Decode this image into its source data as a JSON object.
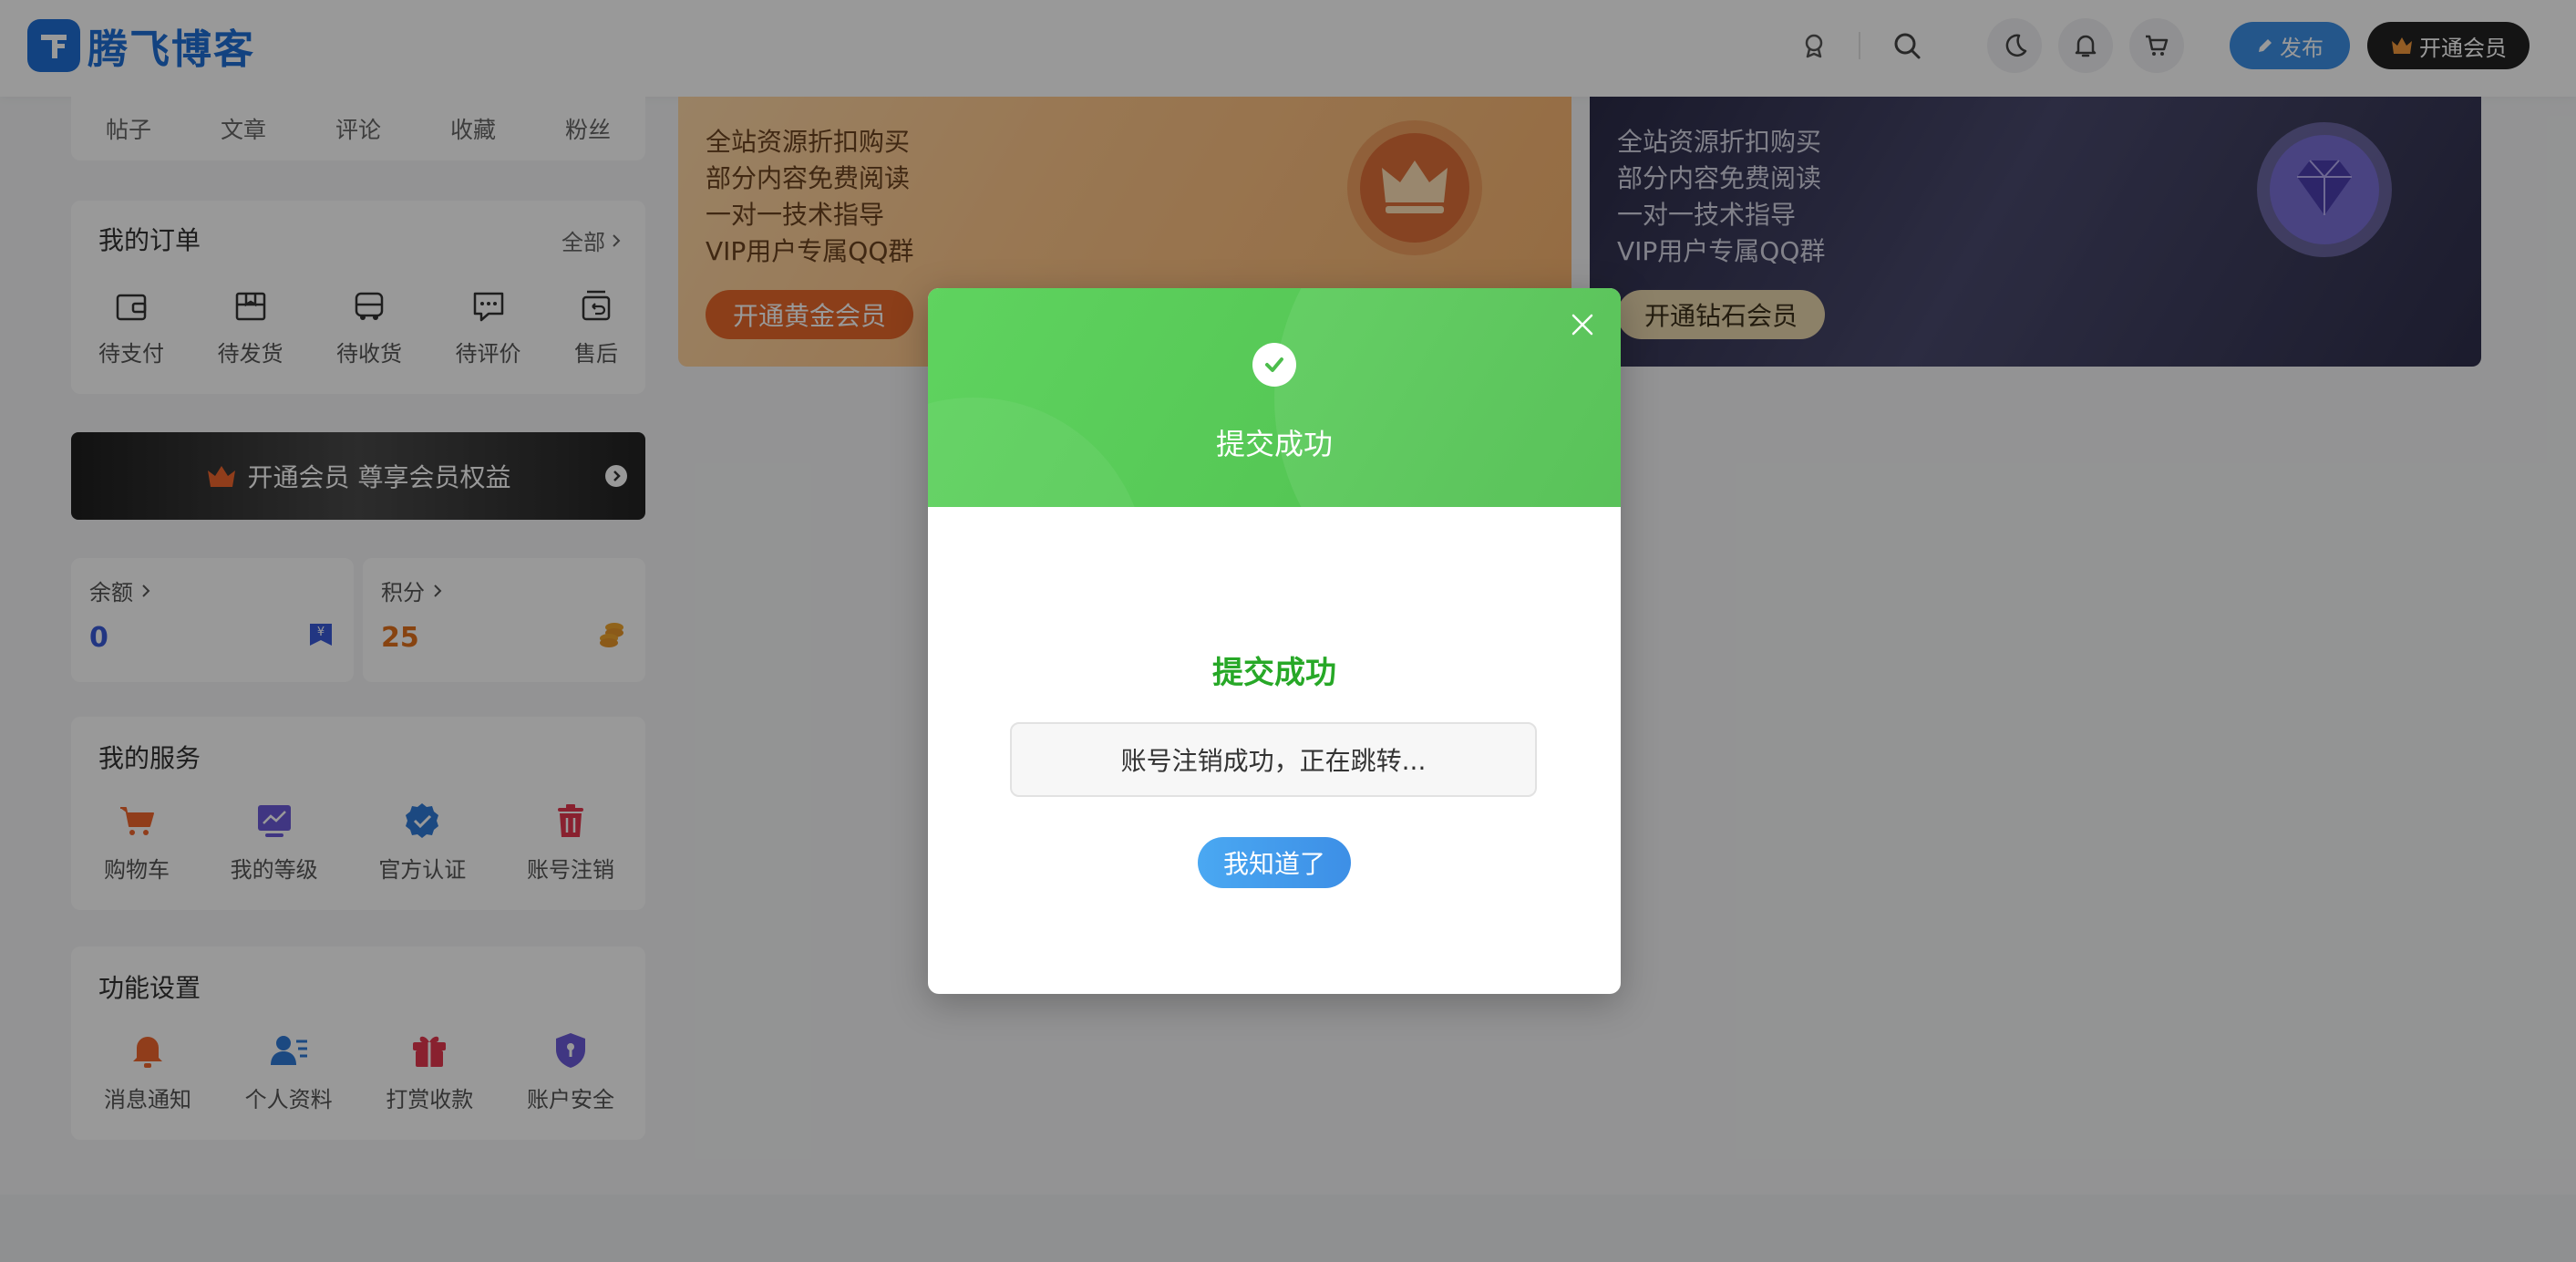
{
  "header": {
    "logo_text": "腾飞博客",
    "publish_label": "发布",
    "vip_label": "开通会员"
  },
  "stats": {
    "items": [
      "帖子",
      "文章",
      "评论",
      "收藏",
      "粉丝"
    ]
  },
  "orders": {
    "title": "我的订单",
    "more": "全部",
    "items": [
      {
        "label": "待支付",
        "icon": "wallet-icon"
      },
      {
        "label": "待发货",
        "icon": "box-icon"
      },
      {
        "label": "待收货",
        "icon": "truck-icon"
      },
      {
        "label": "待评价",
        "icon": "comment-icon"
      },
      {
        "label": "售后",
        "icon": "return-icon"
      }
    ]
  },
  "vip_bar": {
    "label": "开通会员 尊享会员权益"
  },
  "balance": {
    "label": "余额",
    "value": "0",
    "color": "#3a5bd9"
  },
  "points": {
    "label": "积分",
    "value": "25",
    "color": "#e2701c"
  },
  "services": {
    "title": "我的服务",
    "items": [
      {
        "label": "购物车",
        "icon": "cart-icon",
        "color": "#f0662d"
      },
      {
        "label": "我的等级",
        "icon": "level-chart-icon",
        "color": "#6b5bd9"
      },
      {
        "label": "官方认证",
        "icon": "verified-badge-icon",
        "color": "#2f7ad8"
      },
      {
        "label": "账号注销",
        "icon": "trash-icon",
        "color": "#e5384f"
      }
    ]
  },
  "settings": {
    "title": "功能设置",
    "items": [
      {
        "label": "消息通知",
        "icon": "bell-icon",
        "color": "#f0662d"
      },
      {
        "label": "个人资料",
        "icon": "user-profile-icon",
        "color": "#2f7ad8"
      },
      {
        "label": "打赏收款",
        "icon": "gift-icon",
        "color": "#e5384f"
      },
      {
        "label": "账户安全",
        "icon": "shield-icon",
        "color": "#6b5bd9"
      }
    ]
  },
  "banners": {
    "perks": [
      "全站资源折扣购买",
      "部分内容免费阅读",
      "一对一技术指导",
      "VIP用户专属QQ群"
    ],
    "gold_button": "开通黄金会员",
    "diamond_button": "开通钻石会员"
  },
  "modal": {
    "head_title": "提交成功",
    "body_title": "提交成功",
    "message": "账号注销成功，正在跳转...",
    "button": "我知道了",
    "accent": "#27a827"
  }
}
